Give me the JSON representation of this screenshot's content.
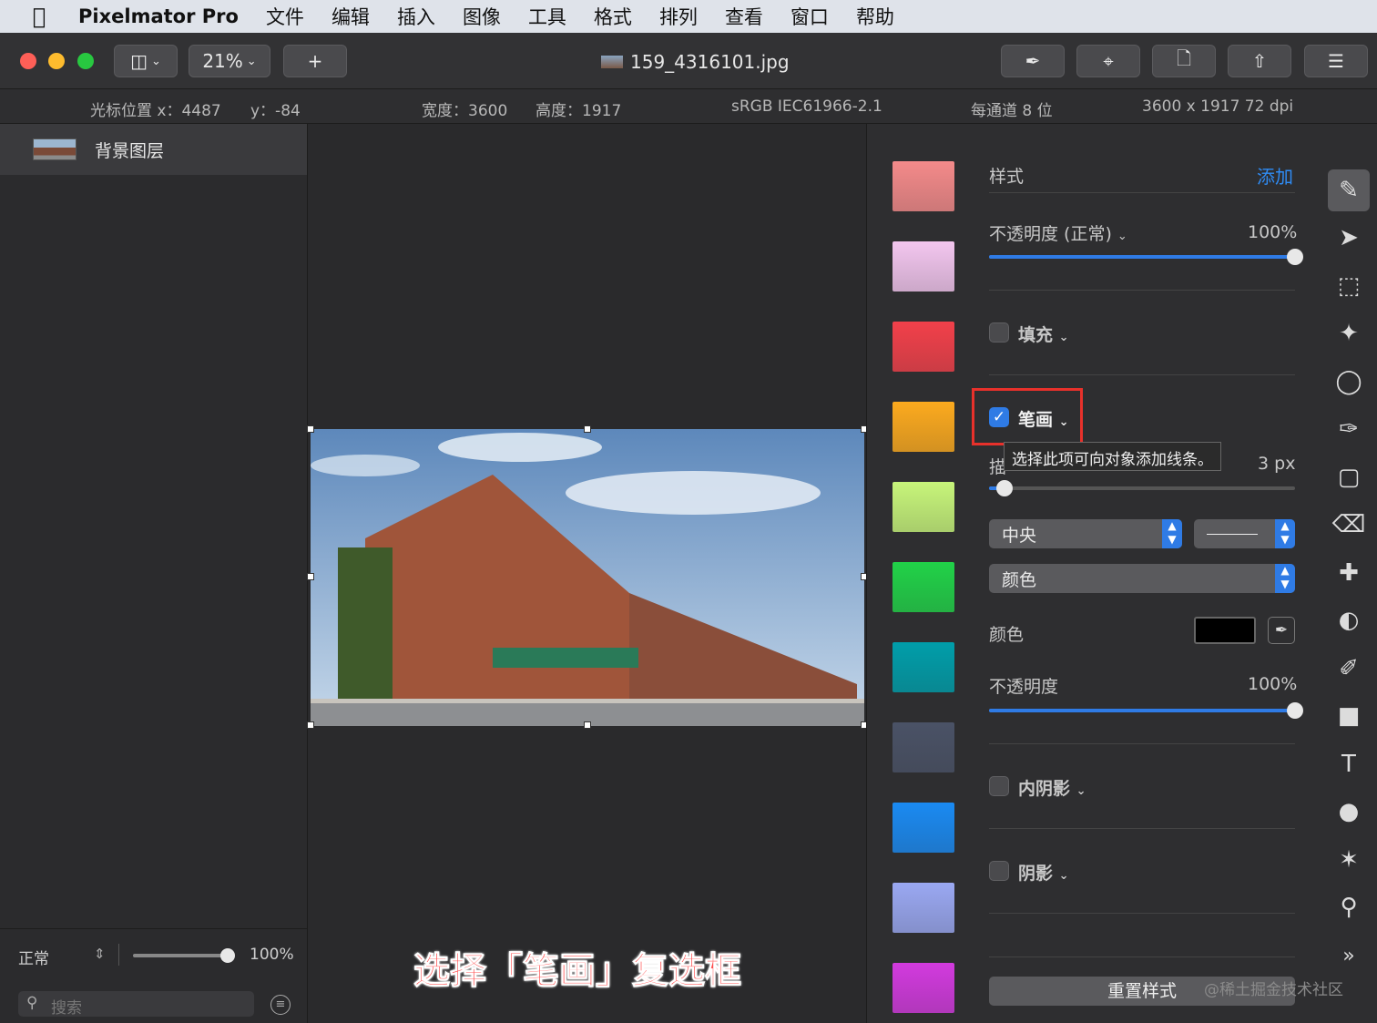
{
  "menubar": {
    "apple_icon": "apple-logo",
    "app_name": "Pixelmator Pro",
    "menus": [
      "文件",
      "编辑",
      "插入",
      "图像",
      "工具",
      "格式",
      "排列",
      "查看",
      "窗口",
      "帮助"
    ]
  },
  "toolbar": {
    "zoom": "21%",
    "add_label": "+",
    "document_title": "159_4316101.jpg"
  },
  "infobar": {
    "cursor_x": "光标位置 x：4487",
    "cursor_y": "y：-84",
    "width": "宽度：3600",
    "height": "高度：1917",
    "color_profile": "sRGB IEC61966-2.1",
    "bit_depth": "每通道 8 位",
    "dimensions": "3600 x 1917 72 dpi"
  },
  "layers": {
    "items": [
      {
        "name": "背景图层"
      }
    ],
    "blend_mode": "正常",
    "opacity": "100%",
    "opacity_value": 1.0,
    "search_placeholder": "搜索"
  },
  "canvas": {
    "caption": "选择「笔画」复选框"
  },
  "style_panel": {
    "header": "样式",
    "add_label": "添加",
    "opacity_label": "不透明度 (正常)",
    "opacity_value": "100%",
    "opacity_fraction": 1.0,
    "fill_label": "填充",
    "fill_checked": false,
    "stroke_label": "笔画",
    "stroke_checked": true,
    "tooltip": "选择此项可向对象添加线条。",
    "stroke_width_label": "描",
    "stroke_width_value": "3 px",
    "stroke_width_fraction": 0.05,
    "position_option": "中央",
    "type_option": "颜色",
    "color_label": "颜色",
    "color_value": "#000000",
    "stroke_opacity_label": "不透明度",
    "stroke_opacity_value": "100%",
    "stroke_opacity_fraction": 1.0,
    "inner_shadow_label": "内阴影",
    "shadow_label": "阴影",
    "reset_label": "重置样式",
    "watermark": "@稀土掘金技术社区",
    "presets": [
      "#f48a8a",
      "#f3c6ef",
      "#f2404a",
      "#fcaa1e",
      "#c7f57a",
      "#21d248",
      "#009eaa",
      "#4a5266",
      "#1a8af2",
      "#9aa8f2",
      "#d23ade"
    ]
  },
  "tools": [
    "style-tool",
    "arrange-tool",
    "select-rect-tool",
    "quick-select-tool",
    "color-select-tool",
    "paint-tool",
    "gradient-tool",
    "eraser-tool",
    "repair-tool",
    "warp-tool",
    "pen-tool",
    "shape-tool",
    "type-tool",
    "effects-tool",
    "distort-tool",
    "zoom-tool",
    "more-tools"
  ]
}
